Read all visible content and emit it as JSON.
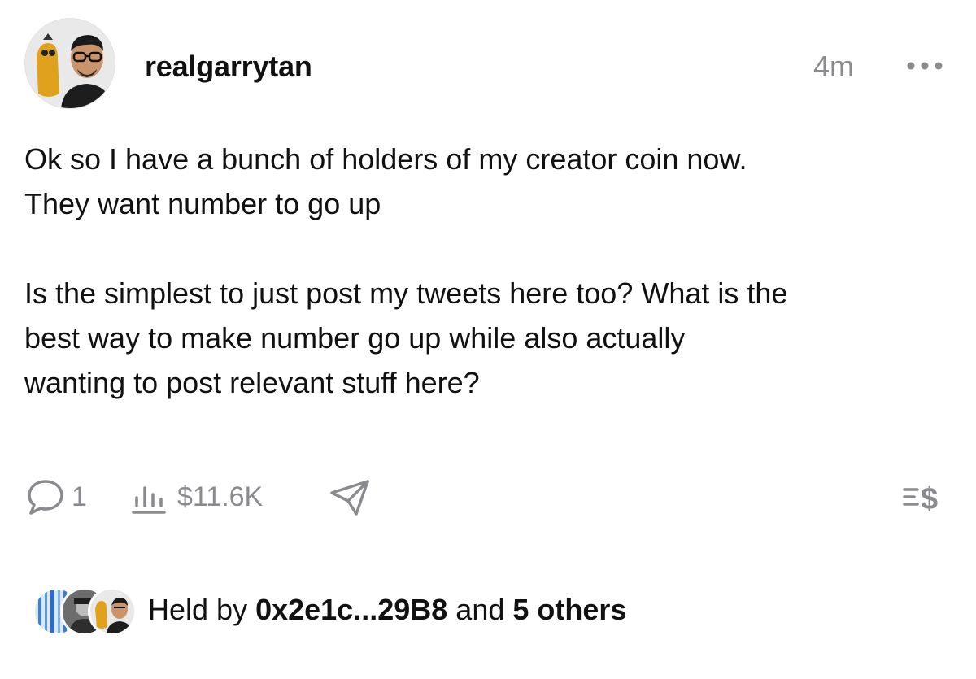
{
  "post": {
    "author": "realgarrytan",
    "time": "4m",
    "paragraphs": [
      "Ok so I have a bunch of holders of my creator coin now.\nThey want number to go up",
      "Is the simplest to just post my tweets here too? What is the\nbest way to make number go up while also actually\nwanting to post relevant stuff here?"
    ]
  },
  "actions": {
    "comments_count": "1",
    "market_cap": "$11.6K",
    "comment_icon": "speech-bubble-icon",
    "stats_icon": "bar-chart-icon",
    "share_icon": "paper-plane-icon",
    "trade_icon": "tip-dollar-icon"
  },
  "holders": {
    "prefix": "Held by",
    "first_holder": "0x2e1c...29B8",
    "joiner": "and",
    "others": "5 others"
  },
  "colors": {
    "text": "#111111",
    "muted": "#8a8a8f",
    "background": "#ffffff"
  }
}
